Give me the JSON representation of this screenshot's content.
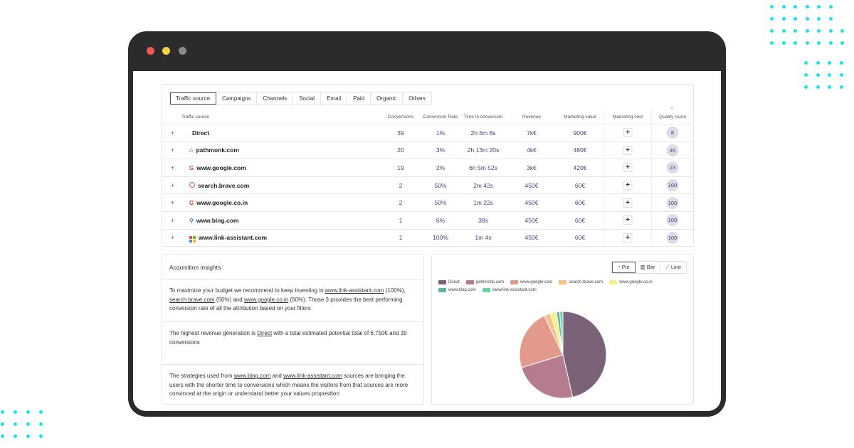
{
  "window": {
    "lights": [
      "#ee5a52",
      "#f5d33f",
      "#8a8a8a"
    ]
  },
  "tabs": [
    "Traffic source",
    "Campaigns",
    "Channels",
    "Social",
    "Email",
    "Paid",
    "Organic",
    "Others"
  ],
  "active_tab": 0,
  "table": {
    "headers": [
      "Traffic source",
      "Conversions",
      "Conversion Rate",
      "Time to conversion",
      "Revenue",
      "Marketing value",
      "Marketing cost",
      "Quality score"
    ],
    "rows": [
      {
        "source": "Direct",
        "icon": "none",
        "conversions": "39",
        "rate": "1%",
        "time": "2h 6m 8s",
        "revenue": "7k€",
        "mvalue": "900€",
        "quality": "8"
      },
      {
        "source": "pathmonk.com",
        "icon": "pathmonk-icon",
        "conversions": "20",
        "rate": "3%",
        "time": "2h 13m 20s",
        "revenue": "4k€",
        "mvalue": "480€",
        "quality": "45"
      },
      {
        "source": "www.google.com",
        "icon": "google-icon",
        "conversions": "19",
        "rate": "2%",
        "time": "6h 5m 52s",
        "revenue": "3k€",
        "mvalue": "420€",
        "quality": "23"
      },
      {
        "source": "search.brave.com",
        "icon": "brave-icon",
        "conversions": "2",
        "rate": "50%",
        "time": "2m 42s",
        "revenue": "450€",
        "mvalue": "60€",
        "quality": "100"
      },
      {
        "source": "www.google.co.in",
        "icon": "google-icon",
        "conversions": "2",
        "rate": "50%",
        "time": "1m 22s",
        "revenue": "450€",
        "mvalue": "60€",
        "quality": "100"
      },
      {
        "source": "www.bing.com",
        "icon": "bing-search-icon",
        "conversions": "1",
        "rate": "6%",
        "time": "38s",
        "revenue": "450€",
        "mvalue": "60€",
        "quality": "100"
      },
      {
        "source": "www.link-assistant.com",
        "icon": "link-assistant-icon",
        "conversions": "1",
        "rate": "100%",
        "time": "1m 4s",
        "revenue": "450€",
        "mvalue": "60€",
        "quality": "100"
      }
    ],
    "add_label": "+",
    "expand_label": "+"
  },
  "insights": {
    "title": "Acquisition insights",
    "sections": [
      [
        {
          "t": "To maximize your budget we recommend to keep investing in "
        },
        {
          "t": "www.link-assistant.com",
          "link": true
        },
        {
          "t": " (100%), "
        },
        {
          "t": "search.brave.com",
          "link": true
        },
        {
          "t": " (50%) and "
        },
        {
          "t": "www.google.co.in",
          "link": true
        },
        {
          "t": " (50%). Those 3 provides the best performing conversion rate of all the attribution based on your filters"
        }
      ],
      [
        {
          "t": "The highest revenue generation is "
        },
        {
          "t": "Direct",
          "link": true
        },
        {
          "t": " with a total estimated potential total of 6,750€ and 39 conversions"
        }
      ],
      [
        {
          "t": "The strategies used from "
        },
        {
          "t": "www.bing.com",
          "link": true
        },
        {
          "t": " and "
        },
        {
          "t": "www.link-assistant.com",
          "link": true
        },
        {
          "t": " sources are bringing the users with the shorter time to conversions which means the visitors from that sources are more convinced at the origin or understand better your values proposition"
        }
      ]
    ]
  },
  "chart_controls": {
    "buttons": [
      "Pie",
      "Bar",
      "Line"
    ],
    "active": 0
  },
  "chart_data": {
    "type": "pie",
    "categories": [
      "Direct",
      "pathmonk.com",
      "www.google.com",
      "search.brave.com",
      "www.google.co.in",
      "www.bing.com",
      "www.link-assistant.com"
    ],
    "values": [
      39,
      20,
      19,
      2,
      2,
      1,
      1
    ],
    "colors": [
      "#7a6378",
      "#b47c8e",
      "#e39a8c",
      "#f7c18c",
      "#f5f090",
      "#5fb4a8",
      "#6dd3a6"
    ],
    "legend": "top"
  },
  "accent": "#1ee3e8"
}
